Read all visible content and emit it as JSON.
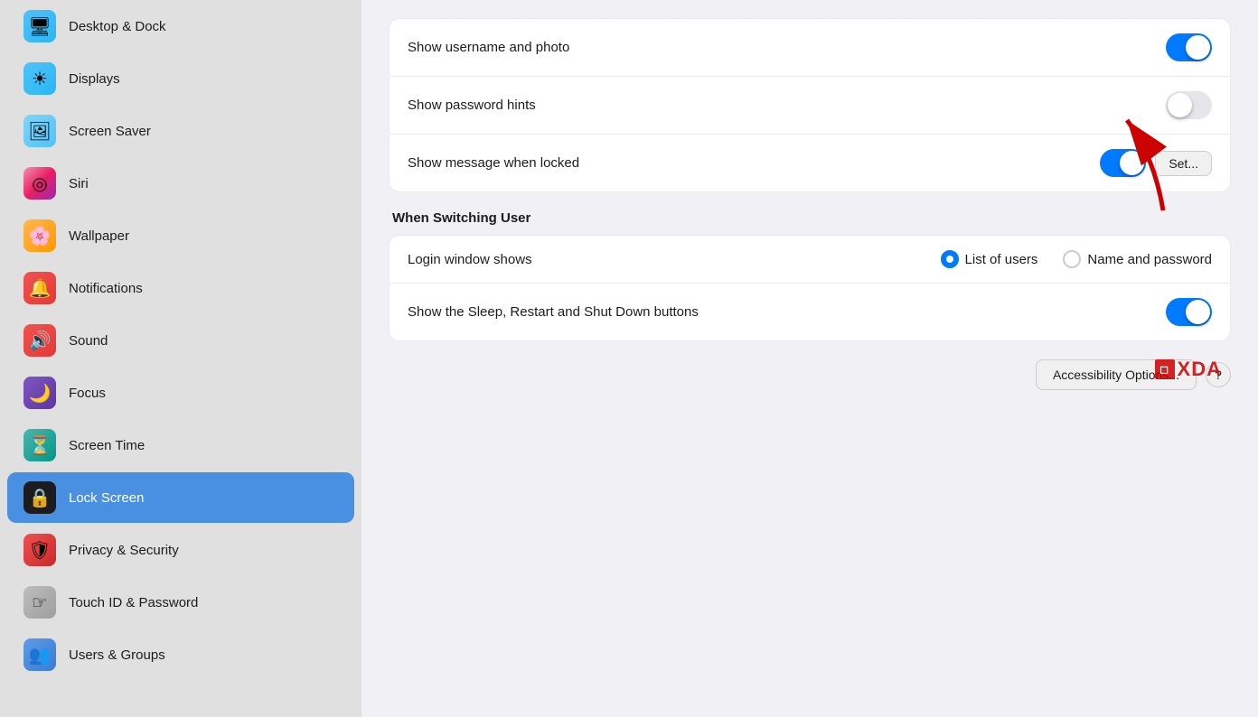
{
  "sidebar": {
    "items": [
      {
        "id": "desktop-dock",
        "label": "Desktop & Dock",
        "icon": "🖥",
        "iconClass": "icon-displays",
        "active": false
      },
      {
        "id": "displays",
        "label": "Displays",
        "icon": "☀",
        "iconClass": "icon-displays",
        "active": false
      },
      {
        "id": "screen-saver",
        "label": "Screen Saver",
        "icon": "🖼",
        "iconClass": "icon-screensaver",
        "active": false
      },
      {
        "id": "siri",
        "label": "Siri",
        "icon": "◎",
        "iconClass": "icon-siri",
        "active": false
      },
      {
        "id": "wallpaper",
        "label": "Wallpaper",
        "icon": "🌸",
        "iconClass": "icon-wallpaper",
        "active": false
      },
      {
        "id": "notifications",
        "label": "Notifications",
        "icon": "🔔",
        "iconClass": "icon-notifications",
        "active": false
      },
      {
        "id": "sound",
        "label": "Sound",
        "icon": "🔊",
        "iconClass": "icon-sound",
        "active": false
      },
      {
        "id": "focus",
        "label": "Focus",
        "icon": "🌙",
        "iconClass": "icon-focus",
        "active": false
      },
      {
        "id": "screen-time",
        "label": "Screen Time",
        "icon": "⏳",
        "iconClass": "icon-screentime",
        "active": false
      },
      {
        "id": "lock-screen",
        "label": "Lock Screen",
        "icon": "🔒",
        "iconClass": "icon-lockscreen",
        "active": true
      },
      {
        "id": "privacy-security",
        "label": "Privacy & Security",
        "icon": "🛡",
        "iconClass": "icon-privacy",
        "active": false
      },
      {
        "id": "touch-id-password",
        "label": "Touch ID & Password",
        "icon": "☞",
        "iconClass": "icon-touchid",
        "active": false
      },
      {
        "id": "users-groups",
        "label": "Users & Groups",
        "icon": "👥",
        "iconClass": "icon-users",
        "active": false
      }
    ]
  },
  "main": {
    "rows": [
      {
        "id": "show-username",
        "label": "Show username and photo",
        "toggle": "on"
      },
      {
        "id": "show-password-hints",
        "label": "Show password hints",
        "toggle": "off"
      },
      {
        "id": "show-message",
        "label": "Show message when locked",
        "toggle": "on",
        "hasSetButton": true
      }
    ],
    "set_button_label": "Set...",
    "when_switching_header": "When Switching User",
    "login_window_label": "Login window shows",
    "radio_option1": "List of users",
    "radio_option2": "Name and password",
    "sleep_row_label": "Show the Sleep, Restart and Shut Down buttons",
    "sleep_toggle": "on",
    "accessibility_btn": "Accessibility Options...",
    "help_btn": "?"
  }
}
